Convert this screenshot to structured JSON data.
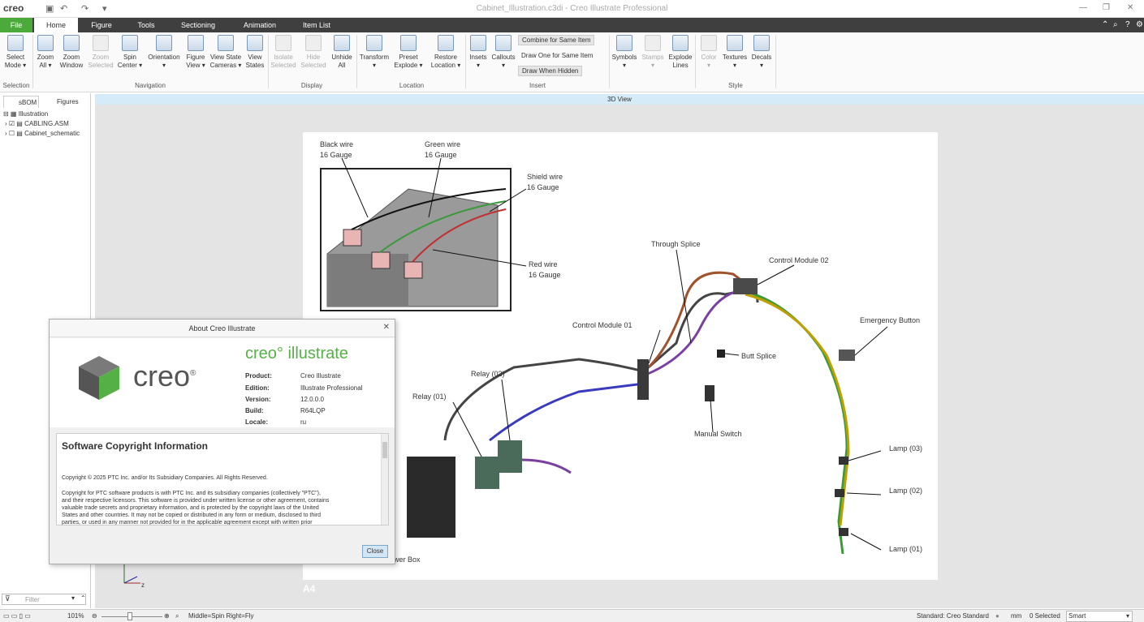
{
  "app": {
    "logo": "creo",
    "window_title": "Cabinet_Illustration.c3di - Creo Illustrate Professional"
  },
  "tabs": [
    "File",
    "Home",
    "Figure",
    "Tools",
    "Sectioning",
    "Animation",
    "Item List"
  ],
  "ribbon": {
    "selection": {
      "select_mode": [
        "Select",
        "Mode ▾"
      ],
      "group": "Selection"
    },
    "navigation": {
      "zoom_all": [
        "Zoom",
        "All ▾"
      ],
      "zoom_window": [
        "Zoom",
        "Window"
      ],
      "zoom_selected": [
        "Zoom",
        "Selected"
      ],
      "spin_center": [
        "Spin",
        "Center ▾"
      ],
      "orientation": [
        "Orientation",
        "▾"
      ],
      "figure_view": [
        "Figure",
        "View ▾"
      ],
      "view_state_cameras": [
        "View State",
        "Cameras ▾"
      ],
      "view_states": [
        "View",
        "States"
      ],
      "group": "Navigation"
    },
    "display": {
      "isolate_selected": [
        "Isolate",
        "Selected"
      ],
      "hide_selected": [
        "Hide",
        "Selected"
      ],
      "unhide_all": [
        "Unhide",
        "All"
      ],
      "group": "Display"
    },
    "location": {
      "transform": [
        "Transform",
        "▾"
      ],
      "preset_explode": [
        "Preset",
        "Explode ▾"
      ],
      "restore_location": [
        "Restore",
        "Location ▾"
      ],
      "group": "Location"
    },
    "insert": {
      "insets": [
        "Insets",
        "▾"
      ],
      "callouts": [
        "Callouts",
        "▾"
      ],
      "combine": "Combine for Same Item",
      "draw_one": "Draw One for Same Item",
      "draw_hidden": "Draw When Hidden",
      "group": "Insert"
    },
    "symbols_group": {
      "symbols": [
        "Symbols",
        "▾"
      ],
      "stamps": [
        "Stamps",
        "▾"
      ],
      "explode_lines": [
        "Explode",
        "Lines"
      ]
    },
    "style": {
      "color": [
        "Color",
        "▾"
      ],
      "textures": [
        "Textures",
        "▾"
      ],
      "decals": [
        "Decals",
        "▾"
      ],
      "group": "Style"
    }
  },
  "left_panel": {
    "tabs": [
      "sBOM",
      "Figures"
    ],
    "tree": [
      "Illustration",
      "CABLING.ASM",
      "Cabinet_schematic"
    ],
    "filter_placeholder": "Filter"
  },
  "view": {
    "header": "3D View",
    "sheet_label": "A4",
    "labels": {
      "black_wire": [
        "Black wire",
        "16 Gauge"
      ],
      "green_wire": [
        "Green wire",
        "16 Gauge"
      ],
      "shield_wire": [
        "Shield wire",
        "16 Gauge"
      ],
      "red_wire": [
        "Red wire",
        "16 Gauge"
      ],
      "through_splice": "Through Splice",
      "control_module_02": "Control Module 02",
      "control_module_01": "Control Module 01",
      "emergency_button": "Emergency Button",
      "butt_splice": "Butt Splice",
      "relay_02": "Relay (02)",
      "relay_01": "Relay (01)",
      "manual_switch": "Manual Switch",
      "lamp_03": "Lamp (03)",
      "lamp_02": "Lamp (02)",
      "lamp_01": "Lamp (01)",
      "power_box": "wer Box"
    }
  },
  "dialog": {
    "title": "About Creo Illustrate",
    "logo_text": "creo",
    "logo_mark": "®",
    "product_logo": "creo° illustrate",
    "info": [
      {
        "label": "Product:",
        "value": "Creo Illustrate"
      },
      {
        "label": "Edition:",
        "value": "Illustrate Professional"
      },
      {
        "label": "Version:",
        "value": "12.0.0.0"
      },
      {
        "label": "Build:",
        "value": "R64LQP"
      },
      {
        "label": "Locale:",
        "value": "ru"
      }
    ],
    "copyright_title": "Software Copyright Information",
    "copyright_line": "Copyright © 2025 PTC Inc. and/or Its Subsidiary Companies. All Rights Reserved.",
    "copyright_body": [
      "Copyright for PTC software products is with PTC Inc. and its subsidiary companies (collectively \"PTC\"),",
      "and their respective licensors. This software is provided under written license or other agreement, contains",
      "valuable trade secrets and proprietary information, and is protected by the copyright laws of the United",
      "States and other countries. It may not be copied or distributed in any form or medium, disclosed to third",
      "parties, or used in any manner not provided for in the applicable agreement except with written prior"
    ],
    "close_button": "Close"
  },
  "status": {
    "zoom": "101%",
    "hint": "Middle=Spin   Right=Fly",
    "standard": "Standard: Creo Standard",
    "unit": "mm",
    "selected": "0 Selected",
    "mode": "Smart"
  },
  "colors": {
    "file_tab": "#4caa3a",
    "tabbar": "#3f3f3f",
    "viewhdr": "#d5ebf7",
    "creo_green": "#55b046"
  }
}
